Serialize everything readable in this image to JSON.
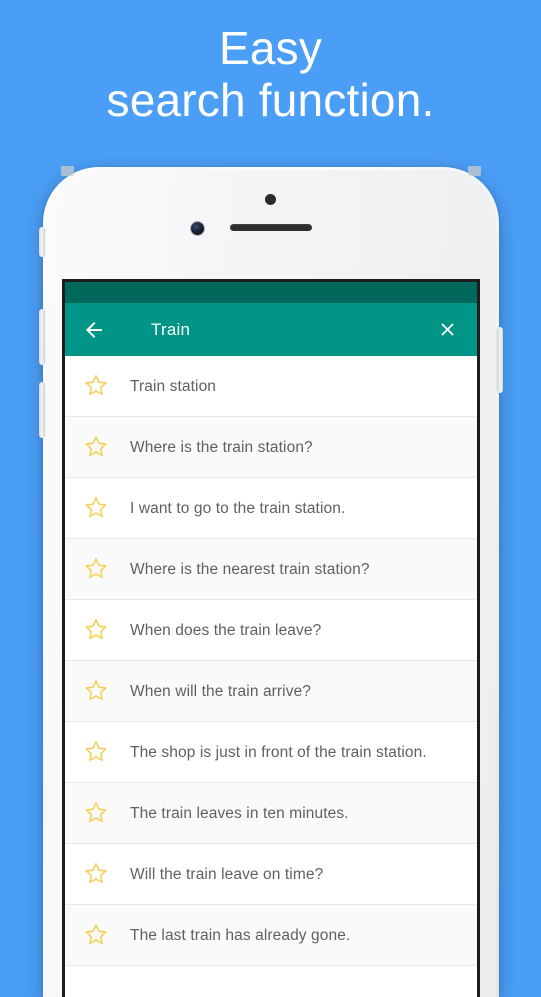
{
  "headline": {
    "line1": "Easy",
    "line2": "search function."
  },
  "colors": {
    "background_blue": "#4a9ef5",
    "statusbar_teal": "#00695c",
    "toolbar_teal": "#009587",
    "star_gold": "#f3d25c",
    "item_text_gray": "#606060",
    "headline_white": "#ffffff"
  },
  "phone": {
    "hardware": {
      "camera": "front-camera",
      "sensor": "proximity-sensor",
      "speaker": "earpiece-speaker",
      "mute_switch": "mute-switch",
      "volume_up": "volume-up-button",
      "volume_down": "volume-down-button",
      "power": "power-button"
    }
  },
  "app": {
    "statusbar": "",
    "toolbar": {
      "back_icon": "arrow-left-icon",
      "title": "Train",
      "close_icon": "close-x-icon"
    },
    "list": {
      "star_icon": "star-outline-icon",
      "items": [
        {
          "text": "Train station"
        },
        {
          "text": "Where is the train station?"
        },
        {
          "text": "I want to go to the train station."
        },
        {
          "text": "Where is the nearest train station?"
        },
        {
          "text": "When does the train leave?"
        },
        {
          "text": "When will the train arrive?"
        },
        {
          "text": "The shop is just in front of the train station."
        },
        {
          "text": "The train leaves in ten minutes."
        },
        {
          "text": "Will the train leave on time?"
        },
        {
          "text": "The last train has already gone."
        }
      ]
    }
  }
}
